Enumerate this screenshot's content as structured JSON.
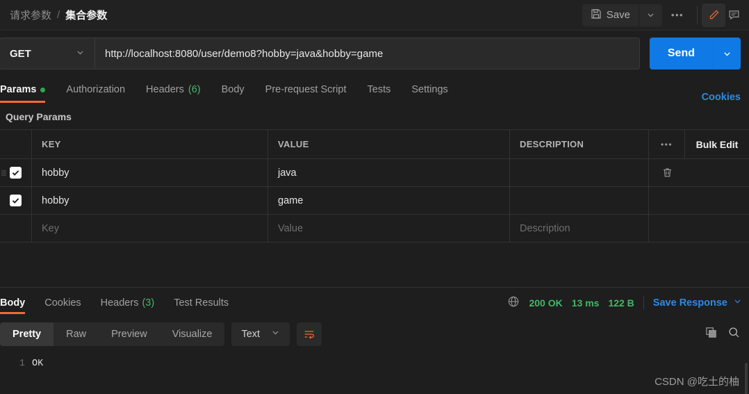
{
  "header": {
    "breadcrumb_parent": "请求参数",
    "breadcrumb_sep": "/",
    "breadcrumb_current": "集合参数",
    "save_label": "Save",
    "more_label": "•••"
  },
  "request": {
    "method": "GET",
    "method_caret": "⌄",
    "url": "http://localhost:8080/user/demo8?hobby=java&hobby=game",
    "send_label": "Send",
    "send_caret": "⌄"
  },
  "request_tabs": [
    {
      "label": "Params",
      "badge": "",
      "has_dot": true,
      "active": true
    },
    {
      "label": "Authorization",
      "badge": "",
      "has_dot": false,
      "active": false
    },
    {
      "label": "Headers",
      "badge": "(6)",
      "has_dot": false,
      "active": false
    },
    {
      "label": "Body",
      "badge": "",
      "has_dot": false,
      "active": false
    },
    {
      "label": "Pre-request Script",
      "badge": "",
      "has_dot": false,
      "active": false
    },
    {
      "label": "Tests",
      "badge": "",
      "has_dot": false,
      "active": false
    },
    {
      "label": "Settings",
      "badge": "",
      "has_dot": false,
      "active": false
    }
  ],
  "cookies_link": "Cookies",
  "query_params": {
    "title": "Query Params",
    "columns": [
      "KEY",
      "VALUE",
      "DESCRIPTION"
    ],
    "dots": "•••",
    "bulk_edit": "Bulk Edit",
    "rows": [
      {
        "checked": true,
        "key": "hobby",
        "value": "java",
        "description": "",
        "has_delete": true
      },
      {
        "checked": true,
        "key": "hobby",
        "value": "game",
        "description": "",
        "has_delete": false
      }
    ],
    "empty_row": {
      "key_placeholder": "Key",
      "value_placeholder": "Value",
      "description_placeholder": "Description"
    }
  },
  "response_tabs": [
    {
      "label": "Body",
      "badge": "",
      "active": true
    },
    {
      "label": "Cookies",
      "badge": "",
      "active": false
    },
    {
      "label": "Headers",
      "badge": "(3)",
      "active": false
    },
    {
      "label": "Test Results",
      "badge": "",
      "active": false
    }
  ],
  "response_status": {
    "status": "200 OK",
    "time": "13 ms",
    "size": "122 B",
    "save_response": "Save Response",
    "save_caret": "⌄"
  },
  "format_bar": {
    "modes": [
      "Pretty",
      "Raw",
      "Preview",
      "Visualize"
    ],
    "active_mode": "Pretty",
    "content_type": "Text",
    "content_type_caret": "⌄"
  },
  "response_body": {
    "line_number": "1",
    "content": "OK"
  },
  "watermark": "CSDN @吃土的柚",
  "colors": {
    "accent_orange": "#f06c35",
    "accent_blue": "#0f7ae5",
    "link_blue": "#2e8ae6",
    "success_green": "#41b96a",
    "background": "#1e1e1e",
    "panel": "#2a2a2a"
  }
}
